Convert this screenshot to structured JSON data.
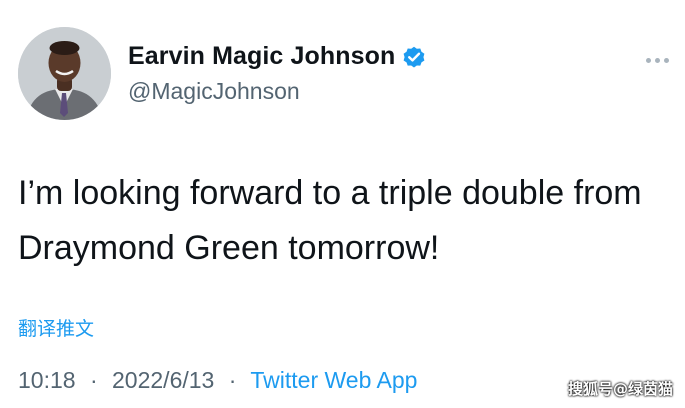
{
  "author": {
    "display_name": "Earvin Magic Johnson",
    "handle": "@MagicJohnson",
    "verified_badge_icon": "verified-badge-icon",
    "verified_color": "#1d9bf0"
  },
  "tweet": {
    "text": "I’m looking forward to a triple double from Draymond Green tomorrow!",
    "translate_label": "翻译推文",
    "time": "10:18",
    "separator": "·",
    "date": "2022/6/13",
    "source": "Twitter Web App"
  },
  "more_menu_icon": "more-dots-icon",
  "watermark": "搜狐号@绿茵猫",
  "colors": {
    "text": "#0f1419",
    "muted": "#536471",
    "accent": "#1d9bf0"
  }
}
